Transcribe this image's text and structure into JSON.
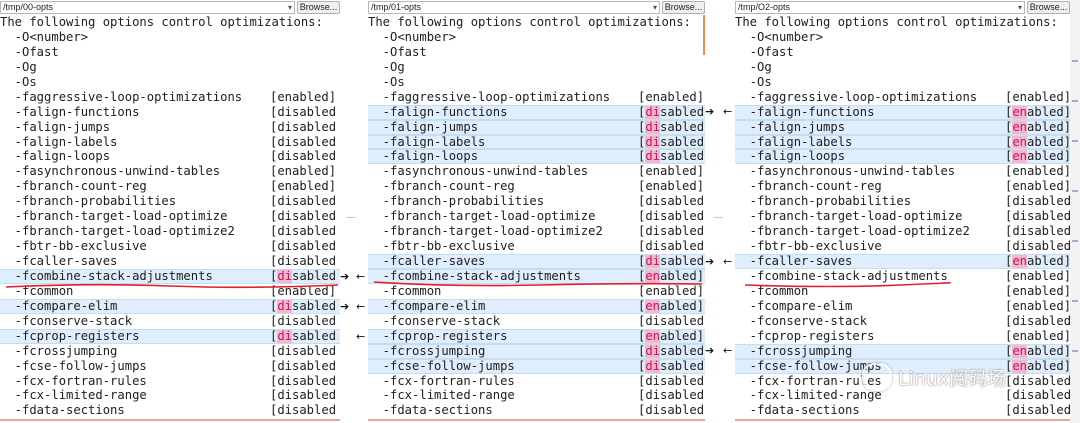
{
  "browse_label": "Browse...",
  "panes": [
    {
      "path": "/tmp/00-opts",
      "lines": [
        {
          "o": "The following options control optimizations:",
          "s": "",
          "h": false,
          "c": 0,
          "p": ""
        },
        {
          "o": "  -O<number>",
          "s": "",
          "h": false,
          "c": 0,
          "p": ""
        },
        {
          "o": "  -Ofast",
          "s": "",
          "h": false,
          "c": 0,
          "p": ""
        },
        {
          "o": "  -Og",
          "s": "",
          "h": false,
          "c": 0,
          "p": ""
        },
        {
          "o": "  -Os",
          "s": "",
          "h": false,
          "c": 0,
          "p": ""
        },
        {
          "o": "  -faggressive-loop-optimizations",
          "s": "[enabled]",
          "h": false,
          "c": 0,
          "p": ""
        },
        {
          "o": "  -falign-functions",
          "s": "[disabled",
          "h": false,
          "c": 0,
          "p": ""
        },
        {
          "o": "  -falign-jumps",
          "s": "[disabled",
          "h": false,
          "c": 0,
          "p": ""
        },
        {
          "o": "  -falign-labels",
          "s": "[disabled",
          "h": false,
          "c": 0,
          "p": ""
        },
        {
          "o": "  -falign-loops",
          "s": "[disabled",
          "h": false,
          "c": 0,
          "p": ""
        },
        {
          "o": "  -fasynchronous-unwind-tables",
          "s": "[enabled]",
          "h": false,
          "c": 0,
          "p": ""
        },
        {
          "o": "  -fbranch-count-reg",
          "s": "[enabled]",
          "h": false,
          "c": 0,
          "p": ""
        },
        {
          "o": "  -fbranch-probabilities",
          "s": "[disabled",
          "h": false,
          "c": 0,
          "p": ""
        },
        {
          "o": "  -fbranch-target-load-optimize",
          "s": "[disabled",
          "h": false,
          "c": 0,
          "p": ""
        },
        {
          "o": "  -fbranch-target-load-optimize2",
          "s": "[disabled",
          "h": false,
          "c": 0,
          "p": ""
        },
        {
          "o": "  -fbtr-bb-exclusive",
          "s": "[disabled",
          "h": false,
          "c": 0,
          "p": ""
        },
        {
          "o": "  -fcaller-saves",
          "s": "[disabled",
          "h": false,
          "c": 0,
          "p": ""
        },
        {
          "o": "  -fcombine-stack-adjustments",
          "s": "[disabled",
          "h": true,
          "c": 2,
          "p": "→"
        },
        {
          "o": "  -fcommon",
          "s": "[enabled]",
          "h": false,
          "c": 0,
          "p": ""
        },
        {
          "o": "  -fcompare-elim",
          "s": "[disabled",
          "h": true,
          "c": 2,
          "p": "→"
        },
        {
          "o": "  -fconserve-stack",
          "s": "[disabled",
          "h": false,
          "c": 0,
          "p": ""
        },
        {
          "o": "  -fcprop-registers",
          "s": "[disabled",
          "h": true,
          "c": 2,
          "p": "→"
        },
        {
          "o": "  -fcrossjumping",
          "s": "[disabled",
          "h": false,
          "c": 0,
          "p": ""
        },
        {
          "o": "  -fcse-follow-jumps",
          "s": "[disabled",
          "h": false,
          "c": 0,
          "p": ""
        },
        {
          "o": "  -fcx-fortran-rules",
          "s": "[disabled",
          "h": false,
          "c": 0,
          "p": ""
        },
        {
          "o": "  -fcx-limited-range",
          "s": "[disabled",
          "h": false,
          "c": 0,
          "p": ""
        },
        {
          "o": "  -fdata-sections",
          "s": "[disabled",
          "h": false,
          "c": 0,
          "p": ""
        }
      ]
    },
    {
      "path": "/tmp/01-opts",
      "lines": [
        {
          "o": "The following options control optimizations:",
          "s": "",
          "h": false,
          "c": 0,
          "p": ""
        },
        {
          "o": "  -O<number>",
          "s": "",
          "h": false,
          "c": 0,
          "p": ""
        },
        {
          "o": "  -Ofast",
          "s": "",
          "h": false,
          "c": 0,
          "p": ""
        },
        {
          "o": "  -Og",
          "s": "",
          "h": false,
          "c": 0,
          "p": ""
        },
        {
          "o": "  -Os",
          "s": "",
          "h": false,
          "c": 0,
          "p": ""
        },
        {
          "o": "  -faggressive-loop-optimizations",
          "s": "[enabled]",
          "h": false,
          "c": 0,
          "p": ""
        },
        {
          "o": "  -falign-functions",
          "s": "[disabled",
          "h": true,
          "c": 2,
          "p": "→ ←"
        },
        {
          "o": "  -falign-jumps",
          "s": "[disabled",
          "h": true,
          "c": 2,
          "p": ""
        },
        {
          "o": "  -falign-labels",
          "s": "[disabled",
          "h": true,
          "c": 2,
          "p": ""
        },
        {
          "o": "  -falign-loops",
          "s": "[disabled",
          "h": true,
          "c": 2,
          "p": ""
        },
        {
          "o": "  -fasynchronous-unwind-tables",
          "s": "[enabled]",
          "h": false,
          "c": 0,
          "p": ""
        },
        {
          "o": "  -fbranch-count-reg",
          "s": "[enabled]",
          "h": false,
          "c": 0,
          "p": ""
        },
        {
          "o": "  -fbranch-probabilities",
          "s": "[disabled",
          "h": false,
          "c": 0,
          "p": ""
        },
        {
          "o": "  -fbranch-target-load-optimize",
          "s": "[disabled",
          "h": false,
          "c": 0,
          "p": "—"
        },
        {
          "o": "  -fbranch-target-load-optimize2",
          "s": "[disabled",
          "h": false,
          "c": 0,
          "p": ""
        },
        {
          "o": "  -fbtr-bb-exclusive",
          "s": "[disabled",
          "h": false,
          "c": 0,
          "p": ""
        },
        {
          "o": "  -fcaller-saves",
          "s": "[disabled",
          "h": true,
          "c": 2,
          "p": "→ ←"
        },
        {
          "o": "  -fcombine-stack-adjustments",
          "s": "[enabled]",
          "h": true,
          "c": 2,
          "p": ""
        },
        {
          "o": "  -fcommon",
          "s": "[enabled]",
          "h": false,
          "c": 0,
          "p": ""
        },
        {
          "o": "  -fcompare-elim",
          "s": "[enabled]",
          "h": true,
          "c": 2,
          "p": ""
        },
        {
          "o": "  -fconserve-stack",
          "s": "[disabled",
          "h": false,
          "c": 0,
          "p": ""
        },
        {
          "o": "  -fcprop-registers",
          "s": "[enabled]",
          "h": true,
          "c": 2,
          "p": ""
        },
        {
          "o": "  -fcrossjumping",
          "s": "[disabled",
          "h": true,
          "c": 2,
          "p": "→ ←"
        },
        {
          "o": "  -fcse-follow-jumps",
          "s": "[disabled",
          "h": true,
          "c": 2,
          "p": ""
        },
        {
          "o": "  -fcx-fortran-rules",
          "s": "[disabled",
          "h": false,
          "c": 0,
          "p": ""
        },
        {
          "o": "  -fcx-limited-range",
          "s": "[disabled",
          "h": false,
          "c": 0,
          "p": ""
        },
        {
          "o": "  -fdata-sections",
          "s": "[disabled",
          "h": false,
          "c": 0,
          "p": ""
        }
      ]
    },
    {
      "path": "/tmp/O2-opts",
      "lines": [
        {
          "o": "The following options control optimizations:",
          "s": "",
          "h": false,
          "c": 0,
          "p": ""
        },
        {
          "o": "  -O<number>",
          "s": "",
          "h": false,
          "c": 0,
          "p": ""
        },
        {
          "o": "  -Ofast",
          "s": "",
          "h": false,
          "c": 0,
          "p": ""
        },
        {
          "o": "  -Og",
          "s": "",
          "h": false,
          "c": 0,
          "p": ""
        },
        {
          "o": "  -Os",
          "s": "",
          "h": false,
          "c": 0,
          "p": ""
        },
        {
          "o": "  -faggressive-loop-optimizations",
          "s": "[enabled]",
          "h": false,
          "c": 0,
          "p": ""
        },
        {
          "o": "  -falign-functions",
          "s": "[enabled]",
          "h": true,
          "c": 2,
          "p": ""
        },
        {
          "o": "  -falign-jumps",
          "s": "[enabled]",
          "h": true,
          "c": 2,
          "p": ""
        },
        {
          "o": "  -falign-labels",
          "s": "[enabled]",
          "h": true,
          "c": 2,
          "p": ""
        },
        {
          "o": "  -falign-loops",
          "s": "[enabled]",
          "h": true,
          "c": 2,
          "p": ""
        },
        {
          "o": "  -fasynchronous-unwind-tables",
          "s": "[enabled]",
          "h": false,
          "c": 0,
          "p": ""
        },
        {
          "o": "  -fbranch-count-reg",
          "s": "[enabled]",
          "h": false,
          "c": 0,
          "p": ""
        },
        {
          "o": "  -fbranch-probabilities",
          "s": "[disabled",
          "h": false,
          "c": 0,
          "p": ""
        },
        {
          "o": "  -fbranch-target-load-optimize",
          "s": "[disabled",
          "h": false,
          "c": 0,
          "p": ""
        },
        {
          "o": "  -fbranch-target-load-optimize2",
          "s": "[disabled",
          "h": false,
          "c": 0,
          "p": ""
        },
        {
          "o": "  -fbtr-bb-exclusive",
          "s": "[disabled",
          "h": false,
          "c": 0,
          "p": ""
        },
        {
          "o": "  -fcaller-saves",
          "s": "[enabled]",
          "h": true,
          "c": 2,
          "p": ""
        },
        {
          "o": "  -fcombine-stack-adjustments",
          "s": "[enabled]",
          "h": false,
          "c": 0,
          "p": ""
        },
        {
          "o": "  -fcommon",
          "s": "[enabled]",
          "h": false,
          "c": 0,
          "p": ""
        },
        {
          "o": "  -fcompare-elim",
          "s": "[enabled]",
          "h": false,
          "c": 0,
          "p": ""
        },
        {
          "o": "  -fconserve-stack",
          "s": "[disabled",
          "h": false,
          "c": 0,
          "p": ""
        },
        {
          "o": "  -fcprop-registers",
          "s": "[enabled]",
          "h": false,
          "c": 0,
          "p": ""
        },
        {
          "o": "  -fcrossjumping",
          "s": "[enabled]",
          "h": true,
          "c": 2,
          "p": ""
        },
        {
          "o": "  -fcse-follow-jumps",
          "s": "[enabled]",
          "h": true,
          "c": 2,
          "p": ""
        },
        {
          "o": "  -fcx-fortran-rules",
          "s": "[disabled",
          "h": false,
          "c": 0,
          "p": ""
        },
        {
          "o": "  -fcx-limited-range",
          "s": "[disabled",
          "h": false,
          "c": 0,
          "p": ""
        },
        {
          "o": "  -fdata-sections",
          "s": "[disabled",
          "h": false,
          "c": 0,
          "p": ""
        }
      ]
    }
  ],
  "gutter_icons": [
    "arrow-right-icon",
    "arrow-left-icon",
    "unchanged-dash-icon"
  ],
  "colors": {
    "highlight": "#dfeefc",
    "changed_text": "#c0185a",
    "changed_bg": "#f6b6ce",
    "annotation": "#e0202a"
  },
  "watermark": "Linux阅码场"
}
